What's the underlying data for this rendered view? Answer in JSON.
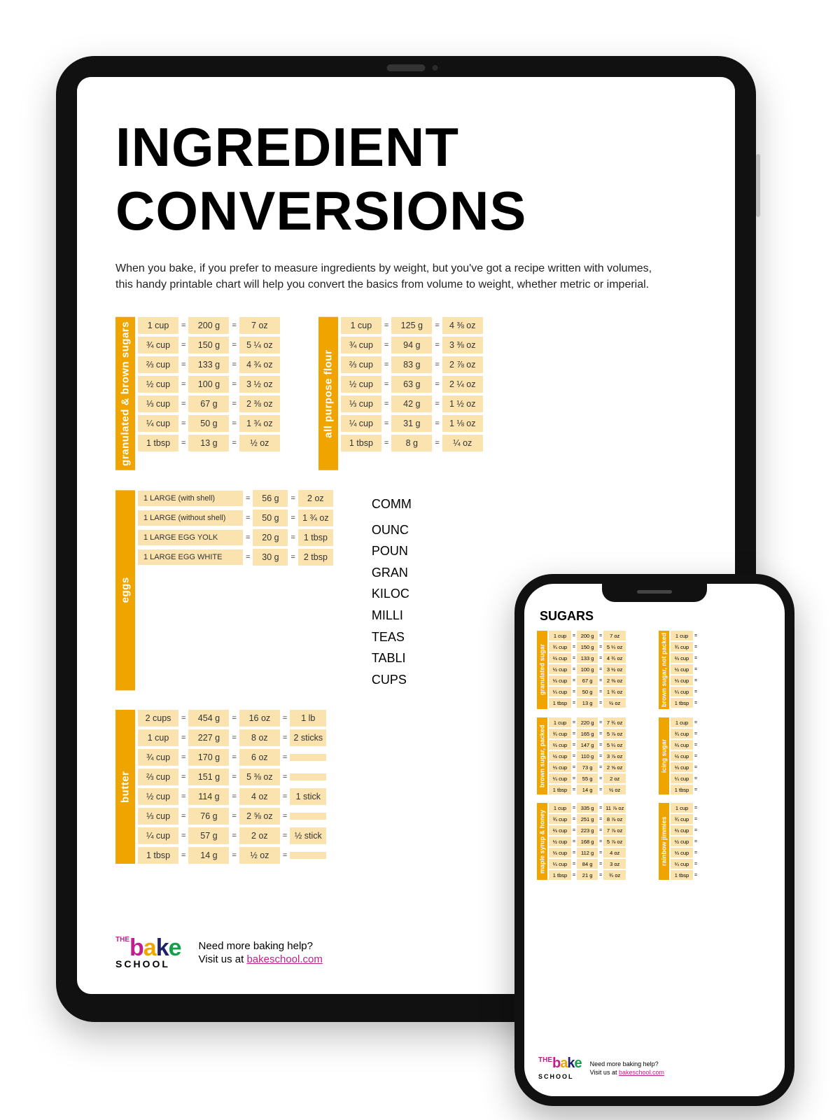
{
  "tablet": {
    "title": "INGREDIENT CONVERSIONS",
    "intro": "When you bake, if you prefer to measure ingredients by weight, but you've got a recipe written with volumes, this handy printable chart will help you convert the basics from volume to weight, whether metric or imperial.",
    "sugars": {
      "label": "granulated & brown sugars",
      "rows": [
        {
          "vol": "1 cup",
          "g": "200 g",
          "oz": "7 oz"
        },
        {
          "vol": "¾ cup",
          "g": "150 g",
          "oz": "5 ¼ oz"
        },
        {
          "vol": "⅔ cup",
          "g": "133 g",
          "oz": "4 ¾ oz"
        },
        {
          "vol": "½ cup",
          "g": "100 g",
          "oz": "3 ½ oz"
        },
        {
          "vol": "⅓ cup",
          "g": "67 g",
          "oz": "2 ⅜ oz"
        },
        {
          "vol": "¼ cup",
          "g": "50 g",
          "oz": "1 ¾ oz"
        },
        {
          "vol": "1 tbsp",
          "g": "13 g",
          "oz": "½ oz"
        }
      ]
    },
    "flour": {
      "label": "all purpose flour",
      "rows": [
        {
          "vol": "1 cup",
          "g": "125 g",
          "oz": "4 ⅜ oz"
        },
        {
          "vol": "¾ cup",
          "g": "94 g",
          "oz": "3 ⅜ oz"
        },
        {
          "vol": "⅔ cup",
          "g": "83 g",
          "oz": "2 ⅞ oz"
        },
        {
          "vol": "½ cup",
          "g": "63 g",
          "oz": "2 ¼ oz"
        },
        {
          "vol": "⅓ cup",
          "g": "42 g",
          "oz": "1 ½ oz"
        },
        {
          "vol": "¼ cup",
          "g": "31 g",
          "oz": "1 ⅛ oz"
        },
        {
          "vol": "1 tbsp",
          "g": "8 g",
          "oz": "¼ oz"
        }
      ]
    },
    "eggs": {
      "label": "eggs",
      "rows": [
        {
          "lbl": "1 LARGE (with shell)",
          "g": "56 g",
          "oz": "2 oz"
        },
        {
          "lbl": "1 LARGE (without shell)",
          "g": "50 g",
          "oz": "1 ¾ oz"
        },
        {
          "lbl": "1 LARGE EGG YOLK",
          "g": "20 g",
          "oz": "1 tbsp"
        },
        {
          "lbl": "1 LARGE EGG WHITE",
          "g": "30 g",
          "oz": "2 tbsp"
        }
      ]
    },
    "common": {
      "title": "COMM",
      "items": [
        "OUNC",
        "POUN",
        "GRAN",
        "KILOC",
        "MILLI",
        "TEAS",
        "TABLI",
        "CUPS"
      ]
    },
    "butter": {
      "label": "butter",
      "rows": [
        {
          "vol": "2 cups",
          "g": "454 g",
          "oz": "16 oz",
          "ex": "1 lb"
        },
        {
          "vol": "1 cup",
          "g": "227 g",
          "oz": "8 oz",
          "ex": "2 sticks"
        },
        {
          "vol": "¾ cup",
          "g": "170 g",
          "oz": "6 oz",
          "ex": ""
        },
        {
          "vol": "⅔ cup",
          "g": "151 g",
          "oz": "5 ⅜ oz",
          "ex": ""
        },
        {
          "vol": "½ cup",
          "g": "114 g",
          "oz": "4 oz",
          "ex": "1 stick"
        },
        {
          "vol": "⅓ cup",
          "g": "76 g",
          "oz": "2 ⅝ oz",
          "ex": ""
        },
        {
          "vol": "¼ cup",
          "g": "57 g",
          "oz": "2 oz",
          "ex": "½ stick"
        },
        {
          "vol": "1 tbsp",
          "g": "14 g",
          "oz": "½ oz",
          "ex": ""
        }
      ]
    },
    "footer": {
      "help1": "Need more baking help?",
      "help2_pre": "Visit us at ",
      "help2_link": "bakeschool.com"
    }
  },
  "phone": {
    "title": "SUGARS",
    "blocks_left": [
      {
        "label": "granulated sugar",
        "rows": [
          {
            "vol": "1 cup",
            "g": "200 g",
            "oz": "7 oz"
          },
          {
            "vol": "¾ cup",
            "g": "150 g",
            "oz": "5 ¼ oz"
          },
          {
            "vol": "⅔ cup",
            "g": "133 g",
            "oz": "4 ¾ oz"
          },
          {
            "vol": "½ cup",
            "g": "100 g",
            "oz": "3 ½ oz"
          },
          {
            "vol": "⅓ cup",
            "g": "67 g",
            "oz": "2 ⅜ oz"
          },
          {
            "vol": "¼ cup",
            "g": "50 g",
            "oz": "1 ¾ oz"
          },
          {
            "vol": "1 tbsp",
            "g": "13 g",
            "oz": "½ oz"
          }
        ]
      },
      {
        "label": "brown sugar, packed",
        "rows": [
          {
            "vol": "1 cup",
            "g": "220 g",
            "oz": "7 ¾ oz"
          },
          {
            "vol": "¾ cup",
            "g": "165 g",
            "oz": "5 ⅞ oz"
          },
          {
            "vol": "⅔ cup",
            "g": "147 g",
            "oz": "5 ¼ oz"
          },
          {
            "vol": "½ cup",
            "g": "110 g",
            "oz": "3 ⅞ oz"
          },
          {
            "vol": "⅓ cup",
            "g": "73 g",
            "oz": "2 ⅝ oz"
          },
          {
            "vol": "¼ cup",
            "g": "55 g",
            "oz": "2 oz"
          },
          {
            "vol": "1 tbsp",
            "g": "14 g",
            "oz": "½ oz"
          }
        ]
      },
      {
        "label": "maple syrup & honey",
        "rows": [
          {
            "vol": "1 cup",
            "g": "335 g",
            "oz": "11 ⅞ oz"
          },
          {
            "vol": "¾ cup",
            "g": "251 g",
            "oz": "8 ⅞ oz"
          },
          {
            "vol": "⅔ cup",
            "g": "223 g",
            "oz": "7 ⅞ oz"
          },
          {
            "vol": "½ cup",
            "g": "168 g",
            "oz": "5 ⅞ oz"
          },
          {
            "vol": "⅓ cup",
            "g": "112 g",
            "oz": "4 oz"
          },
          {
            "vol": "¼ cup",
            "g": "84 g",
            "oz": "3 oz"
          },
          {
            "vol": "1 tbsp",
            "g": "21 g",
            "oz": "¾ oz"
          }
        ]
      }
    ],
    "blocks_right": [
      {
        "label": "brown sugar, not packed",
        "rows": [
          {
            "vol": "1 cup",
            "eq": "="
          },
          {
            "vol": "¾ cup",
            "eq": "="
          },
          {
            "vol": "⅔ cup",
            "eq": "="
          },
          {
            "vol": "½ cup",
            "eq": "="
          },
          {
            "vol": "⅓ cup",
            "eq": "="
          },
          {
            "vol": "¼ cup",
            "eq": "="
          },
          {
            "vol": "1 tbsp",
            "eq": "="
          }
        ]
      },
      {
        "label": "icing sugar",
        "rows": [
          {
            "vol": "1 cup",
            "eq": "="
          },
          {
            "vol": "¾ cup",
            "eq": "="
          },
          {
            "vol": "⅔ cup",
            "eq": "="
          },
          {
            "vol": "½ cup",
            "eq": "="
          },
          {
            "vol": "⅓ cup",
            "eq": "="
          },
          {
            "vol": "¼ cup",
            "eq": "="
          },
          {
            "vol": "1 tbsp",
            "eq": "="
          }
        ]
      },
      {
        "label": "rainbow jimmies",
        "rows": [
          {
            "vol": "1 cup",
            "eq": "="
          },
          {
            "vol": "¾ cup",
            "eq": "="
          },
          {
            "vol": "⅔ cup",
            "eq": "="
          },
          {
            "vol": "½ cup",
            "eq": "="
          },
          {
            "vol": "⅓ cup",
            "eq": "="
          },
          {
            "vol": "¼ cup",
            "eq": "="
          },
          {
            "vol": "1 tbsp",
            "eq": "="
          }
        ]
      }
    ],
    "footer": {
      "help1": "Need more baking help?",
      "help2_pre": "Visit us at ",
      "help2_link": "bakeschool.com"
    }
  }
}
